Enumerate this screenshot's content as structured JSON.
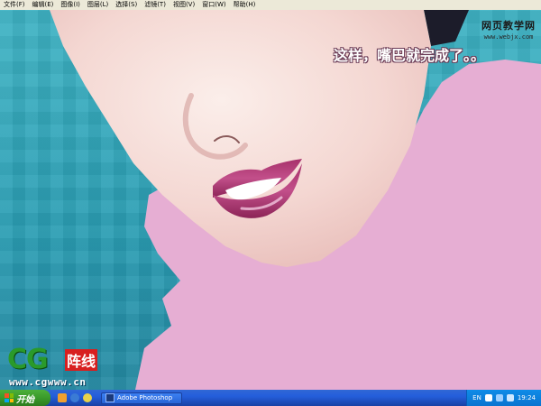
{
  "app": {
    "name": "Adobe Photoshop"
  },
  "menubar": {
    "items": [
      "文件(F)",
      "编辑(E)",
      "图像(I)",
      "图层(L)",
      "选择(S)",
      "滤镜(T)",
      "视图(V)",
      "窗口(W)",
      "帮助(H)"
    ]
  },
  "watermark": {
    "title": "网页教学网",
    "url": "www.webjx.com"
  },
  "caption": "这样，嘴巴就完成了。。",
  "logo": {
    "brand": "CG",
    "brand_zh": "阵线",
    "url": "www.cgwww.cn"
  },
  "taskbar": {
    "start_label": "开始",
    "task_label": "Adobe Photoshop",
    "language": "EN",
    "clock": "19:24"
  },
  "colors": {
    "background_teal": "#2b9fb3",
    "skin": "#f6dcd8",
    "pink_fill": "#e6aed3",
    "lips": "#b03a78"
  },
  "icons": [
    "windows-flag-icon",
    "photoshop-icon",
    "ie-icon",
    "folder-icon",
    "help-icon",
    "volume-icon",
    "network-icon"
  ]
}
